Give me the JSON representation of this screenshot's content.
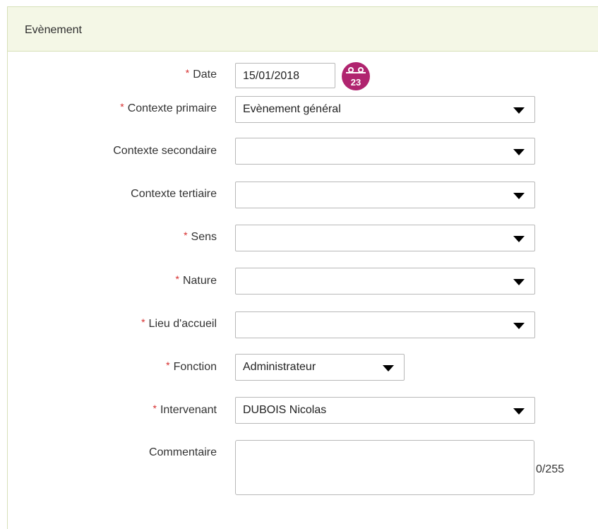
{
  "panel": {
    "title": "Evènement"
  },
  "required_mark": "*",
  "fields": {
    "date": {
      "label": "Date",
      "value": "15/01/2018"
    },
    "contexte_primaire": {
      "label": "Contexte primaire",
      "value": "Evènement général"
    },
    "contexte_secondaire": {
      "label": "Contexte secondaire",
      "value": ""
    },
    "contexte_tertiaire": {
      "label": "Contexte tertiaire",
      "value": ""
    },
    "sens": {
      "label": "Sens",
      "value": ""
    },
    "nature": {
      "label": "Nature",
      "value": ""
    },
    "lieu_accueil": {
      "label": "Lieu d'accueil",
      "value": ""
    },
    "fonction": {
      "label": "Fonction",
      "value": "Administrateur"
    },
    "intervenant": {
      "label": "Intervenant",
      "value": "DUBOIS Nicolas"
    },
    "commentaire": {
      "label": "Commentaire",
      "value": "",
      "counter": "0/255"
    }
  },
  "calendar_icon": {
    "name": "calendar-icon",
    "day": "23",
    "color": "#b0246f"
  },
  "colors": {
    "header_bg": "#f4f7e6",
    "header_border": "#d7e0b8",
    "required": "#d62d2d"
  }
}
